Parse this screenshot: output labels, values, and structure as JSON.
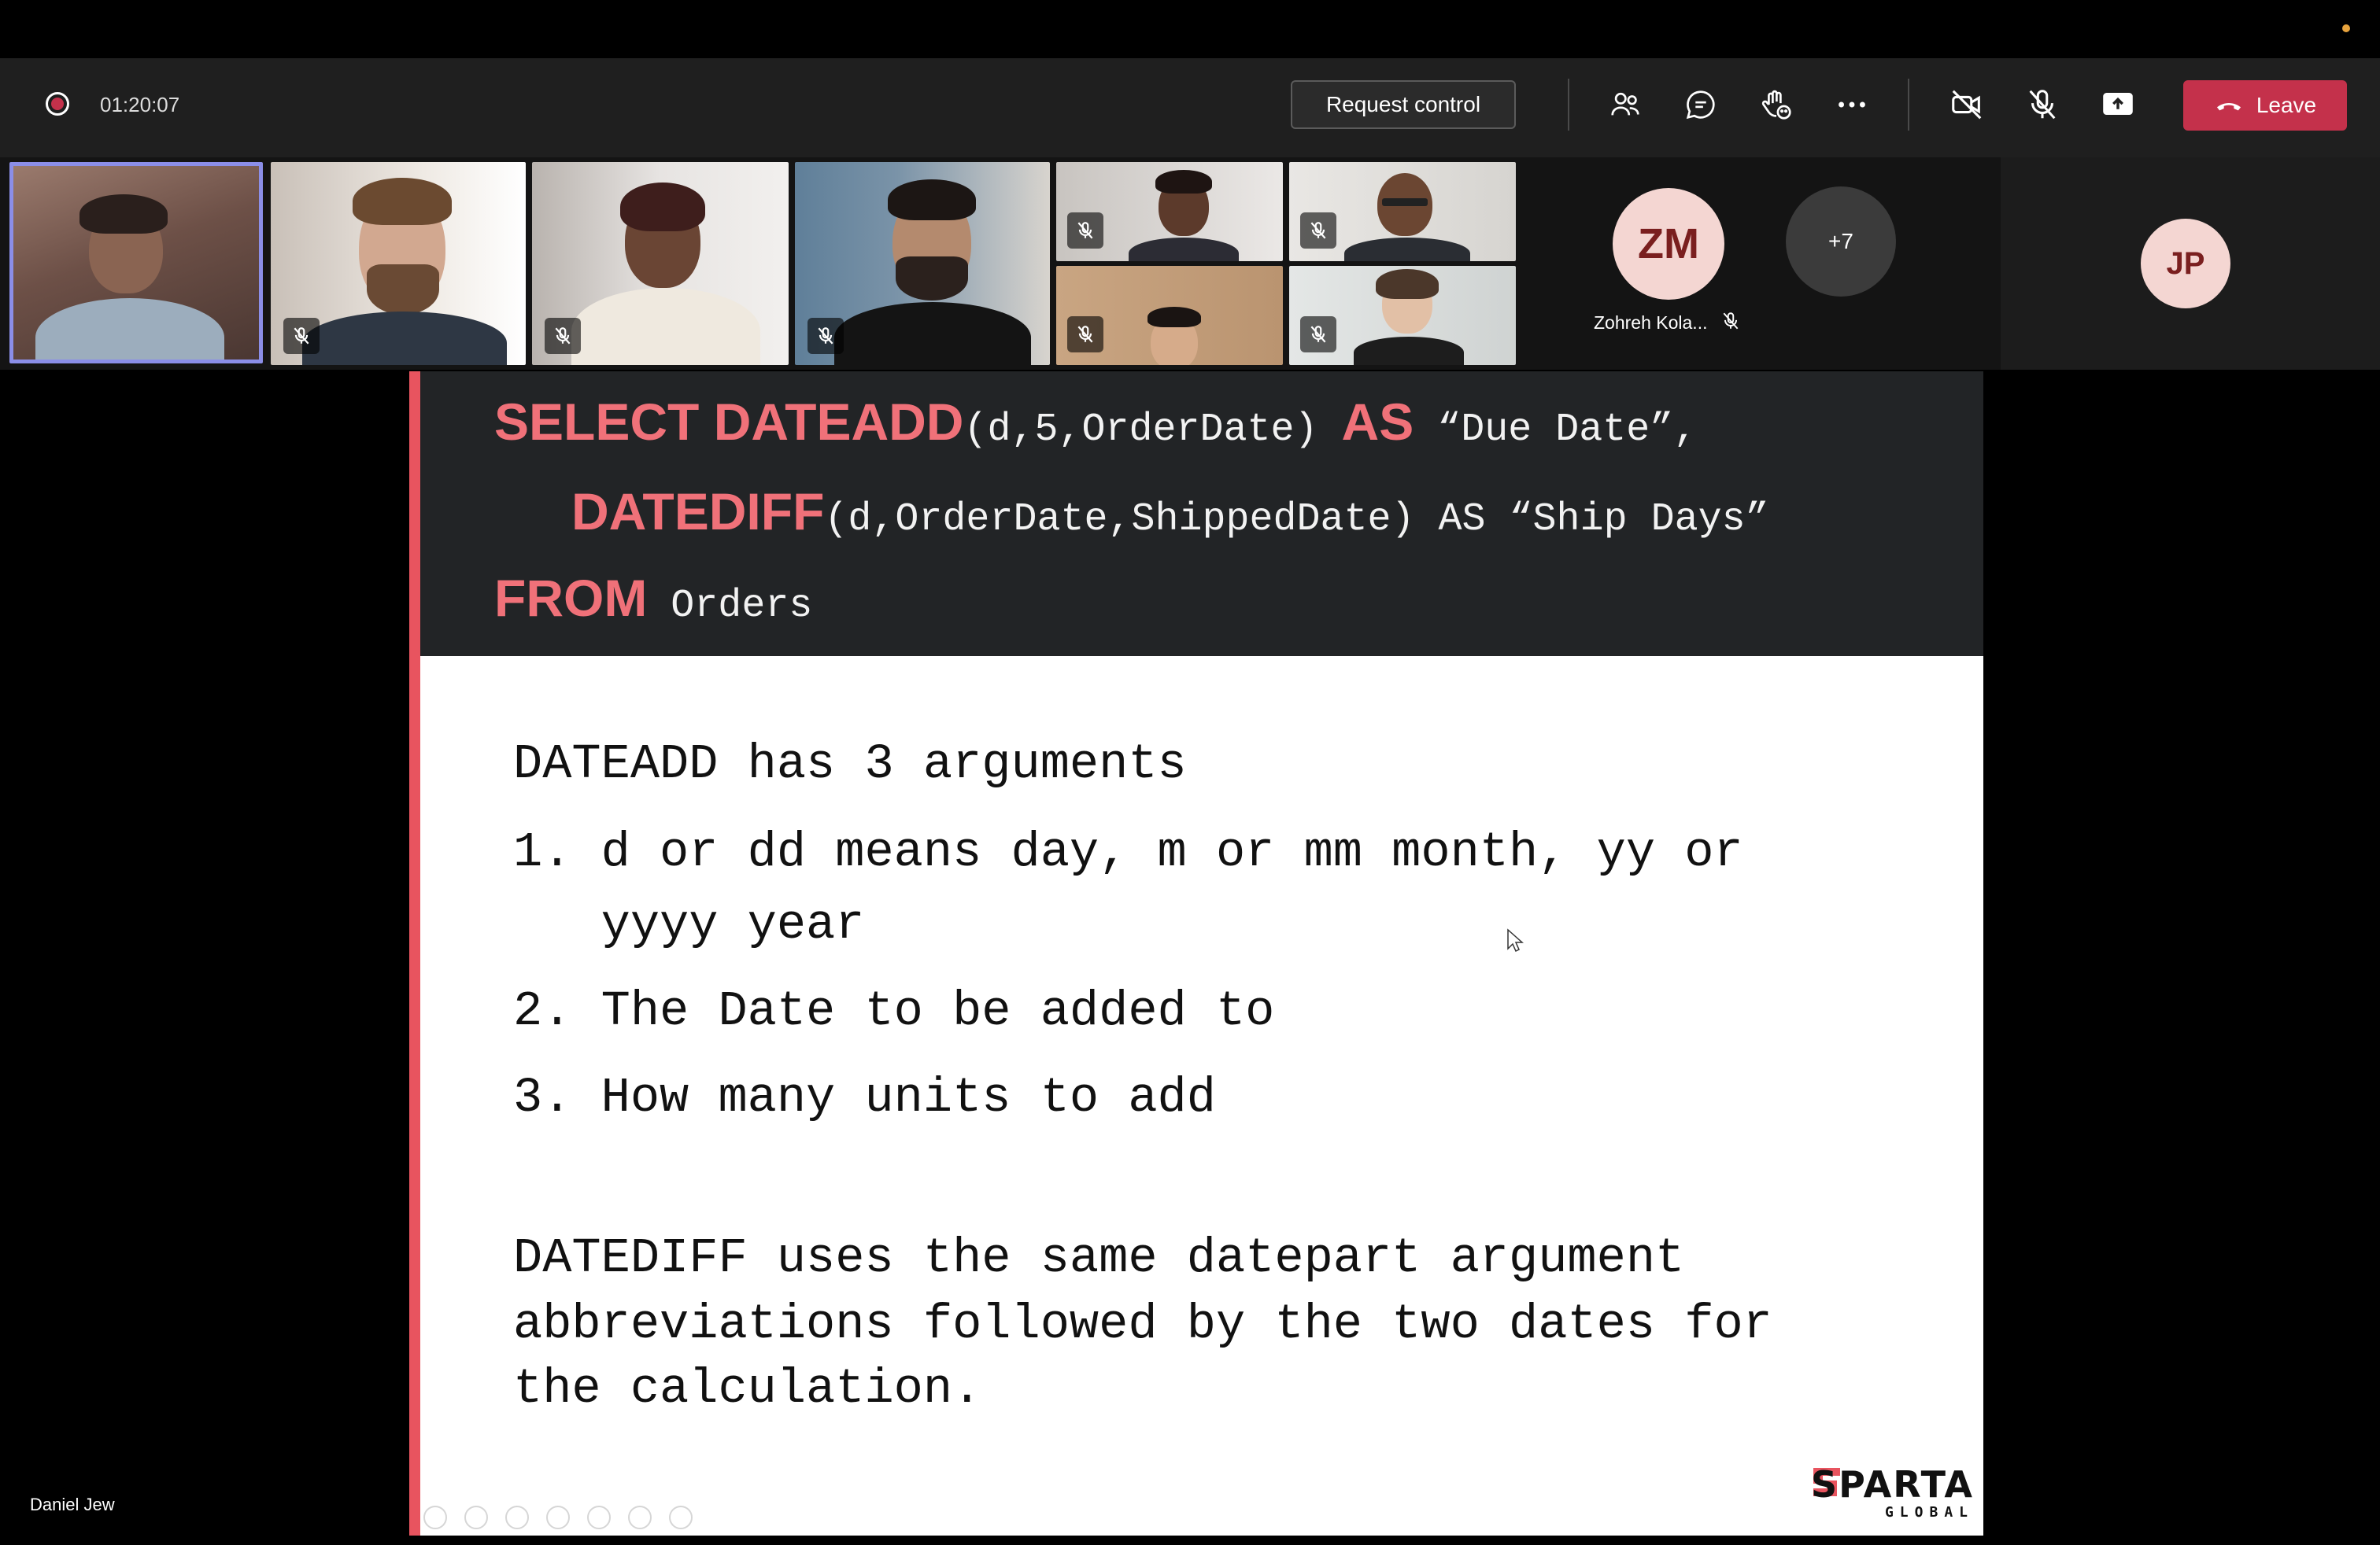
{
  "meeting": {
    "timer": "01:20:07",
    "request_control_label": "Request control",
    "leave_label": "Leave"
  },
  "toolbar_icons": [
    "people-icon",
    "chat-icon",
    "raise-hand-icon",
    "more-icon",
    "camera-off-icon",
    "mic-off-icon",
    "share-screen-icon"
  ],
  "participants": {
    "zm": {
      "initials": "ZM",
      "name": "Zohreh Kola..."
    },
    "overflow_count": "+7",
    "jp": {
      "initials": "JP"
    }
  },
  "presenter": {
    "name": "Daniel Jew"
  },
  "slide": {
    "code_line1_kw1": "SELECT DATEADD",
    "code_line1_arg": "(d,5,OrderDate) ",
    "code_line1_kw2": "AS",
    "code_line1_rest": " “Due Date”,",
    "code_line2_kw": "DATEDIFF",
    "code_line2_rest": "(d,OrderDate,ShippedDate) AS “Ship Days”",
    "code_line3_kw": "FROM",
    "code_line3_rest": " Orders",
    "heading": "DATEADD has 3 arguments",
    "item1_line1": "1. d or dd means day, m or mm month, yy or",
    "item1_line2": "   yyyy year",
    "item2": "2. The Date to be added to",
    "item3": "3. How many units to add",
    "para_line1": "DATEDIFF uses the same datepart argument",
    "para_line2": "abbreviations followed by the two dates for",
    "para_line3": "the calculation.",
    "logo_word": "SPARTA",
    "logo_sub": "GLOBAL"
  },
  "colors": {
    "leave": "#c4314b",
    "slide_accent": "#e8545f",
    "keyword": "#f07179",
    "active_border": "#8b8ee8"
  }
}
